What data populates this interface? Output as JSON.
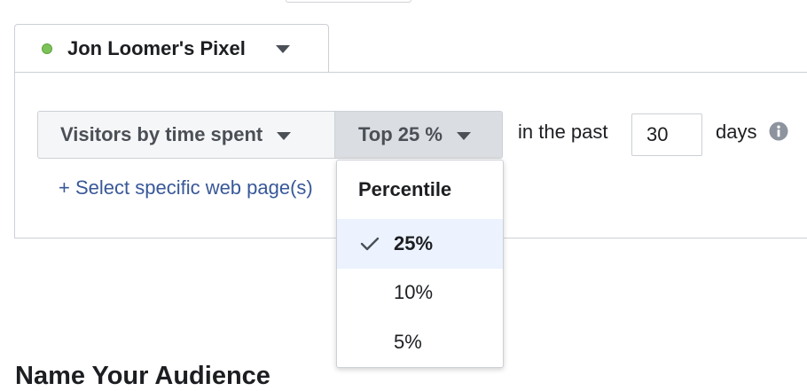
{
  "pixel": {
    "name": "Jon Loomer's Pixel",
    "status_color": "#7cc259"
  },
  "rule": {
    "type_label": "Visitors by time spent",
    "percentile_label": "Top 25 %",
    "past_label": "in the past",
    "days_value": "30",
    "days_label": "days",
    "link_label": "+ Select specific web page(s)"
  },
  "dropdown": {
    "header": "Percentile",
    "options": [
      {
        "label": "25%",
        "selected": true
      },
      {
        "label": "10%",
        "selected": false
      },
      {
        "label": "5%",
        "selected": false
      }
    ]
  },
  "section": {
    "heading": "Name Your Audience"
  },
  "icons": [
    "chevron-down-icon",
    "info-icon",
    "checkmark-icon",
    "status-dot"
  ]
}
